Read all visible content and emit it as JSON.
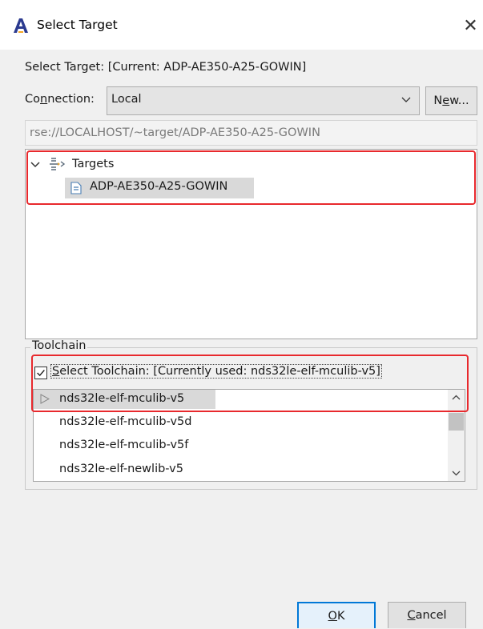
{
  "window": {
    "title": "Select Target",
    "app_icon": "app-logo-icon",
    "close_icon": "close-icon",
    "close_glyph": "✕"
  },
  "header": {
    "text": "Select Target: [Current: ADP-AE350-A25-GOWIN]"
  },
  "connection": {
    "label_pre": "Co",
    "label_mnemonic": "n",
    "label_post": "nection:",
    "value": "Local",
    "new_pre": "N",
    "new_mnemonic": "e",
    "new_post": "w..."
  },
  "path": {
    "value": "rse://LOCALHOST/~target/ADP-AE350-A25-GOWIN"
  },
  "tree": {
    "root_label": "Targets",
    "child_label": "ADP-AE350-A25-GOWIN"
  },
  "toolchain": {
    "group_label": "Toolchain",
    "checkbox_checked": true,
    "check_mnemonic": "S",
    "check_label_rest": "elect Toolchain: [Currently used: nds32le-elf-mculib-v5]",
    "items": [
      "nds32le-elf-mculib-v5",
      "nds32le-elf-mculib-v5d",
      "nds32le-elf-mculib-v5f",
      "nds32le-elf-newlib-v5"
    ],
    "selected_index": 0
  },
  "buttons": {
    "ok_mnemonic": "O",
    "ok_rest": "K",
    "cancel_mnemonic": "C",
    "cancel_rest": "ancel"
  },
  "colors": {
    "highlight_border": "#e8292d",
    "default_button_border": "#0078d7",
    "selection_background": "#d9d9d9"
  }
}
